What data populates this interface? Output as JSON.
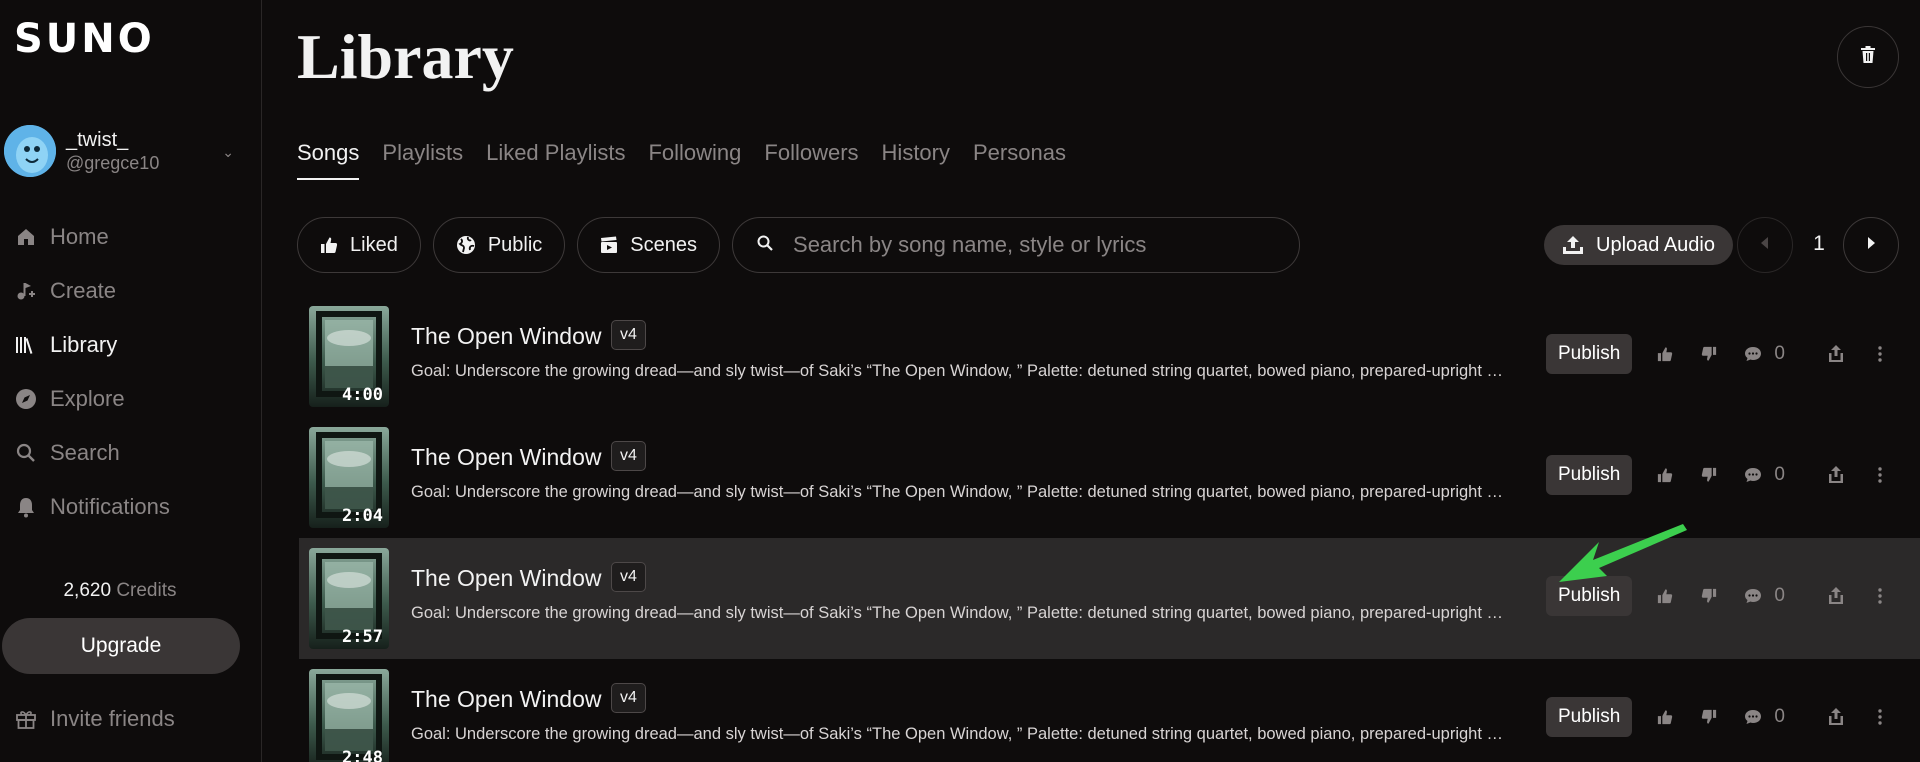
{
  "sidebar": {
    "logo": "SUNO",
    "profile": {
      "name": "_twist_",
      "handle": "@gregce10"
    },
    "nav": [
      {
        "label": "Home",
        "icon": "home-icon"
      },
      {
        "label": "Create",
        "icon": "create-icon"
      },
      {
        "label": "Library",
        "icon": "library-icon"
      },
      {
        "label": "Explore",
        "icon": "explore-icon"
      },
      {
        "label": "Search",
        "icon": "search-icon"
      },
      {
        "label": "Notifications",
        "icon": "bell-icon"
      }
    ],
    "credits": {
      "amount": "2,620",
      "label": "Credits"
    },
    "upgrade": "Upgrade",
    "invite": "Invite friends"
  },
  "main": {
    "title": "Library",
    "tabs": [
      "Songs",
      "Playlists",
      "Liked Playlists",
      "Following",
      "Followers",
      "History",
      "Personas"
    ],
    "filters": {
      "liked": "Liked",
      "public": "Public",
      "scenes": "Scenes"
    },
    "search": {
      "placeholder": "Search by song name, style or lyrics",
      "value": ""
    },
    "upload": "Upload Audio",
    "page": "1"
  },
  "songs": [
    {
      "title": "The Open Window",
      "version": "v4",
      "duration": "4:00",
      "description": "Goal: Underscore the growing dread—and sly twist—of Saki’s “The Open Window, ” Palette: detuned string quartet, bowed piano, prepared-upright hits, muted brass swells, eerie celesta",
      "publish": "Publish",
      "comments": "0"
    },
    {
      "title": "The Open Window",
      "version": "v4",
      "duration": "2:04",
      "description": "Goal: Underscore the growing dread—and sly twist—of Saki’s “The Open Window, ” Palette: detuned string quartet, bowed piano, prepared-upright hits, muted brass swells, eerie celesta",
      "publish": "Publish",
      "comments": "0"
    },
    {
      "title": "The Open Window",
      "version": "v4",
      "duration": "2:57",
      "description": "Goal: Underscore the growing dread—and sly twist—of Saki’s “The Open Window, ” Palette: detuned string quartet, bowed piano, prepared-upright hits, muted brass swells, eerie celesta",
      "publish": "Publish",
      "comments": "0"
    },
    {
      "title": "The Open Window",
      "version": "v4",
      "duration": "2:48",
      "description": "Goal: Underscore the growing dread—and sly twist—of Saki’s “The Open Window, ” Palette: detuned string quartet, bowed piano, prepared-upright hits, muted brass swells, eerie celesta",
      "publish": "Publish",
      "comments": "0"
    }
  ],
  "colors": {
    "background": "#0e0c0c",
    "highlight_row": "#2b2929",
    "annotation_arrow": "#3ccf4e"
  }
}
